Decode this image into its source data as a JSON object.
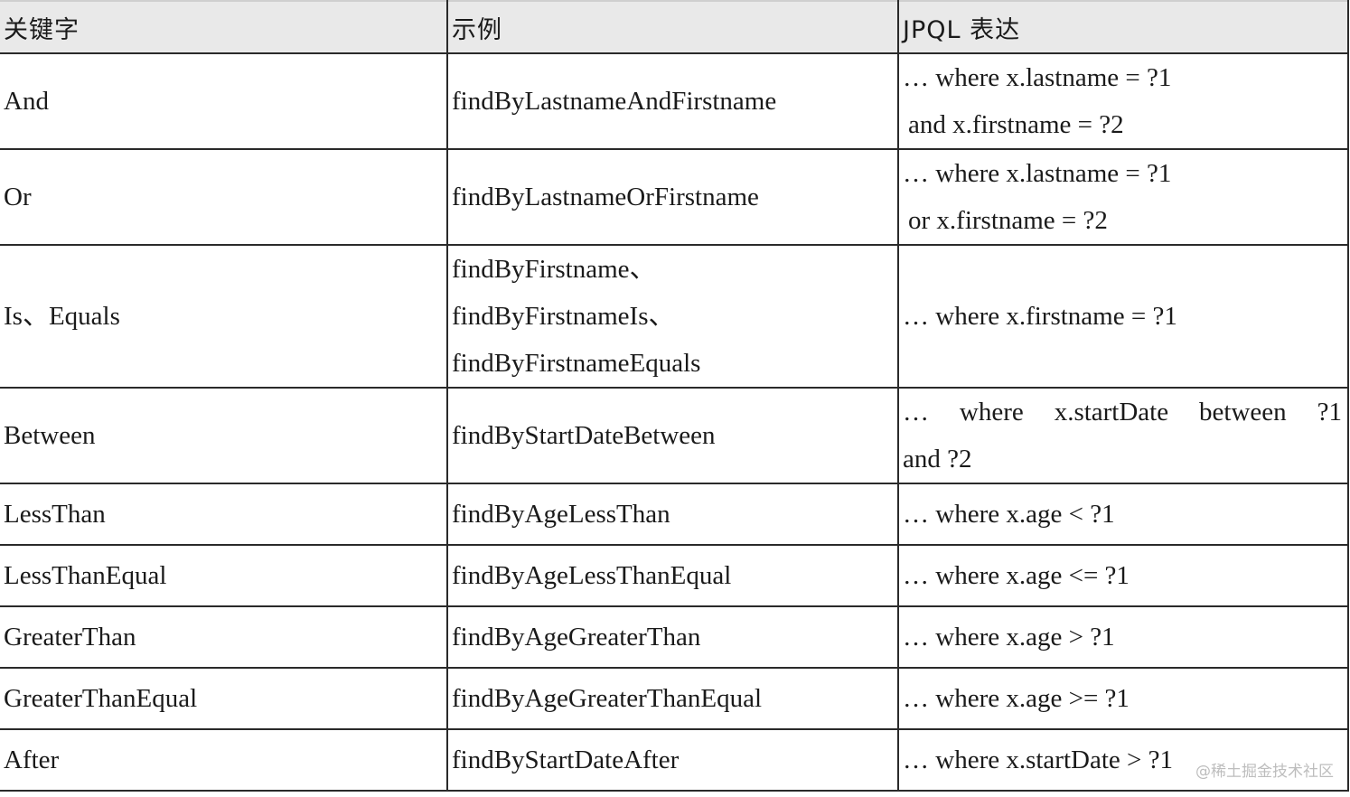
{
  "table": {
    "headers": {
      "keyword": "关键字",
      "example": "示例",
      "jpql": "JPQL 表达"
    },
    "rows": [
      {
        "keyword": "And",
        "example": [
          "findByLastnameAndFirstname"
        ],
        "jpql": [
          "… where x.lastname = ?1",
          "and x.firstname = ?2"
        ]
      },
      {
        "keyword": "Or",
        "example": [
          "findByLastnameOrFirstname"
        ],
        "jpql": [
          "… where x.lastname = ?1",
          "or x.firstname = ?2"
        ]
      },
      {
        "keyword": "Is、Equals",
        "example": [
          "findByFirstname、",
          "findByFirstnameIs、",
          "findByFirstnameEquals"
        ],
        "jpql": [
          "… where x.firstname = ?1"
        ]
      },
      {
        "keyword": "Between",
        "example": [
          "findByStartDateBetween"
        ],
        "jpql": [
          "…",
          "where",
          "x.startDate",
          "between",
          "?1",
          "and ?2"
        ]
      },
      {
        "keyword": "LessThan",
        "example": [
          "findByAgeLessThan"
        ],
        "jpql": [
          "… where x.age < ?1"
        ]
      },
      {
        "keyword": "LessThanEqual",
        "example": [
          "findByAgeLessThanEqual"
        ],
        "jpql": [
          "… where x.age <= ?1"
        ]
      },
      {
        "keyword": "GreaterThan",
        "example": [
          "findByAgeGreaterThan"
        ],
        "jpql": [
          "… where x.age > ?1"
        ]
      },
      {
        "keyword": "GreaterThanEqual",
        "example": [
          "findByAgeGreaterThanEqual"
        ],
        "jpql": [
          "… where x.age >= ?1"
        ]
      },
      {
        "keyword": "After",
        "example": [
          "findByStartDateAfter"
        ],
        "jpql": [
          "… where x.startDate > ?1"
        ]
      }
    ]
  },
  "watermark": "@稀土掘金技术社区"
}
